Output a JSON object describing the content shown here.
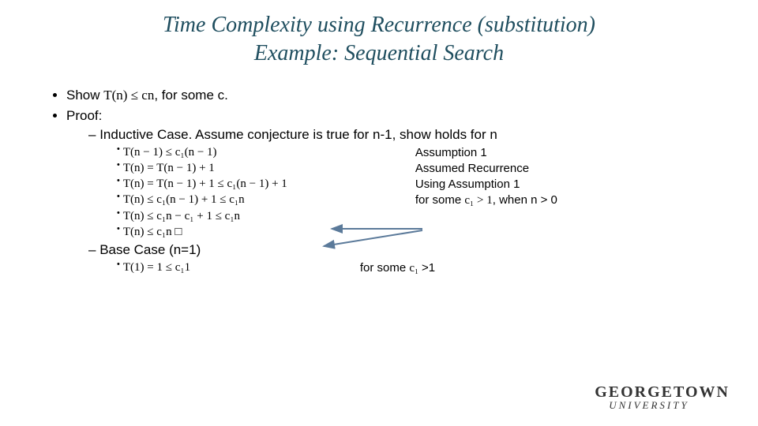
{
  "title_line1": "Time Complexity using Recurrence (substitution)",
  "title_line2": "Example: Sequential Search",
  "b1_show_prefix": "Show ",
  "b1_show_math": "T(n) ≤ cn",
  "b1_show_suffix": ", for some c.",
  "b2_proof": "Proof:",
  "inductive_case": "Inductive Case. Assume conjecture is true for n-1, show holds for n",
  "ic_l1_math": "T(n − 1) ≤ c₁(n − 1)",
  "ic_l1_note": "Assumption 1",
  "ic_l2_math": "T(n) = T(n − 1) + 1",
  "ic_l2_note": "Assumed Recurrence",
  "ic_l3_math": "T(n) = T(n − 1) + 1 ≤ c₁(n − 1) + 1",
  "ic_l3_note": "Using Assumption 1",
  "ic_l4_math": "T(n) ≤ c₁(n − 1) + 1 ≤ c₁n",
  "ic_l4_note_prefix": "for some ",
  "ic_l4_note_math": "c₁ > 1",
  "ic_l4_note_suffix": ", when n > 0",
  "ic_l5_math": "T(n) ≤ c₁n − c₁ + 1 ≤ c₁n",
  "ic_l6_math": "T(n) ≤ c₁n □",
  "base_case": "Base Case (n=1)",
  "bc_l1_math": "T(1) = 1 ≤ c₁1",
  "bc_l1_note_prefix": "for some ",
  "bc_l1_note_math": "c₁ ",
  "bc_l1_note_suffix": ">1",
  "logo_top": "GEORGETOWN",
  "logo_bot": "UNIVERSITY"
}
